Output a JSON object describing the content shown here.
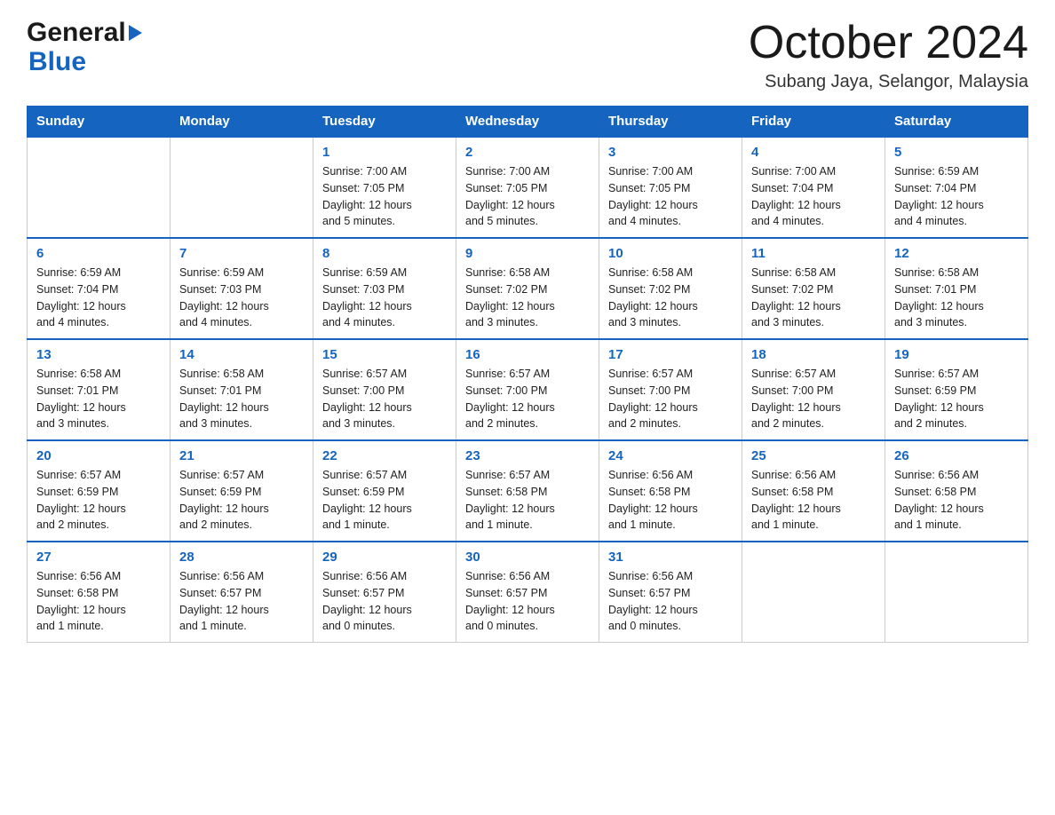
{
  "logo": {
    "line1": "General",
    "line2": "Blue"
  },
  "header": {
    "title": "October 2024",
    "subtitle": "Subang Jaya, Selangor, Malaysia"
  },
  "columns": [
    "Sunday",
    "Monday",
    "Tuesday",
    "Wednesday",
    "Thursday",
    "Friday",
    "Saturday"
  ],
  "weeks": [
    [
      {
        "day": "",
        "info": ""
      },
      {
        "day": "",
        "info": ""
      },
      {
        "day": "1",
        "info": "Sunrise: 7:00 AM\nSunset: 7:05 PM\nDaylight: 12 hours\nand 5 minutes."
      },
      {
        "day": "2",
        "info": "Sunrise: 7:00 AM\nSunset: 7:05 PM\nDaylight: 12 hours\nand 5 minutes."
      },
      {
        "day": "3",
        "info": "Sunrise: 7:00 AM\nSunset: 7:05 PM\nDaylight: 12 hours\nand 4 minutes."
      },
      {
        "day": "4",
        "info": "Sunrise: 7:00 AM\nSunset: 7:04 PM\nDaylight: 12 hours\nand 4 minutes."
      },
      {
        "day": "5",
        "info": "Sunrise: 6:59 AM\nSunset: 7:04 PM\nDaylight: 12 hours\nand 4 minutes."
      }
    ],
    [
      {
        "day": "6",
        "info": "Sunrise: 6:59 AM\nSunset: 7:04 PM\nDaylight: 12 hours\nand 4 minutes."
      },
      {
        "day": "7",
        "info": "Sunrise: 6:59 AM\nSunset: 7:03 PM\nDaylight: 12 hours\nand 4 minutes."
      },
      {
        "day": "8",
        "info": "Sunrise: 6:59 AM\nSunset: 7:03 PM\nDaylight: 12 hours\nand 4 minutes."
      },
      {
        "day": "9",
        "info": "Sunrise: 6:58 AM\nSunset: 7:02 PM\nDaylight: 12 hours\nand 3 minutes."
      },
      {
        "day": "10",
        "info": "Sunrise: 6:58 AM\nSunset: 7:02 PM\nDaylight: 12 hours\nand 3 minutes."
      },
      {
        "day": "11",
        "info": "Sunrise: 6:58 AM\nSunset: 7:02 PM\nDaylight: 12 hours\nand 3 minutes."
      },
      {
        "day": "12",
        "info": "Sunrise: 6:58 AM\nSunset: 7:01 PM\nDaylight: 12 hours\nand 3 minutes."
      }
    ],
    [
      {
        "day": "13",
        "info": "Sunrise: 6:58 AM\nSunset: 7:01 PM\nDaylight: 12 hours\nand 3 minutes."
      },
      {
        "day": "14",
        "info": "Sunrise: 6:58 AM\nSunset: 7:01 PM\nDaylight: 12 hours\nand 3 minutes."
      },
      {
        "day": "15",
        "info": "Sunrise: 6:57 AM\nSunset: 7:00 PM\nDaylight: 12 hours\nand 3 minutes."
      },
      {
        "day": "16",
        "info": "Sunrise: 6:57 AM\nSunset: 7:00 PM\nDaylight: 12 hours\nand 2 minutes."
      },
      {
        "day": "17",
        "info": "Sunrise: 6:57 AM\nSunset: 7:00 PM\nDaylight: 12 hours\nand 2 minutes."
      },
      {
        "day": "18",
        "info": "Sunrise: 6:57 AM\nSunset: 7:00 PM\nDaylight: 12 hours\nand 2 minutes."
      },
      {
        "day": "19",
        "info": "Sunrise: 6:57 AM\nSunset: 6:59 PM\nDaylight: 12 hours\nand 2 minutes."
      }
    ],
    [
      {
        "day": "20",
        "info": "Sunrise: 6:57 AM\nSunset: 6:59 PM\nDaylight: 12 hours\nand 2 minutes."
      },
      {
        "day": "21",
        "info": "Sunrise: 6:57 AM\nSunset: 6:59 PM\nDaylight: 12 hours\nand 2 minutes."
      },
      {
        "day": "22",
        "info": "Sunrise: 6:57 AM\nSunset: 6:59 PM\nDaylight: 12 hours\nand 1 minute."
      },
      {
        "day": "23",
        "info": "Sunrise: 6:57 AM\nSunset: 6:58 PM\nDaylight: 12 hours\nand 1 minute."
      },
      {
        "day": "24",
        "info": "Sunrise: 6:56 AM\nSunset: 6:58 PM\nDaylight: 12 hours\nand 1 minute."
      },
      {
        "day": "25",
        "info": "Sunrise: 6:56 AM\nSunset: 6:58 PM\nDaylight: 12 hours\nand 1 minute."
      },
      {
        "day": "26",
        "info": "Sunrise: 6:56 AM\nSunset: 6:58 PM\nDaylight: 12 hours\nand 1 minute."
      }
    ],
    [
      {
        "day": "27",
        "info": "Sunrise: 6:56 AM\nSunset: 6:58 PM\nDaylight: 12 hours\nand 1 minute."
      },
      {
        "day": "28",
        "info": "Sunrise: 6:56 AM\nSunset: 6:57 PM\nDaylight: 12 hours\nand 1 minute."
      },
      {
        "day": "29",
        "info": "Sunrise: 6:56 AM\nSunset: 6:57 PM\nDaylight: 12 hours\nand 0 minutes."
      },
      {
        "day": "30",
        "info": "Sunrise: 6:56 AM\nSunset: 6:57 PM\nDaylight: 12 hours\nand 0 minutes."
      },
      {
        "day": "31",
        "info": "Sunrise: 6:56 AM\nSunset: 6:57 PM\nDaylight: 12 hours\nand 0 minutes."
      },
      {
        "day": "",
        "info": ""
      },
      {
        "day": "",
        "info": ""
      }
    ]
  ]
}
